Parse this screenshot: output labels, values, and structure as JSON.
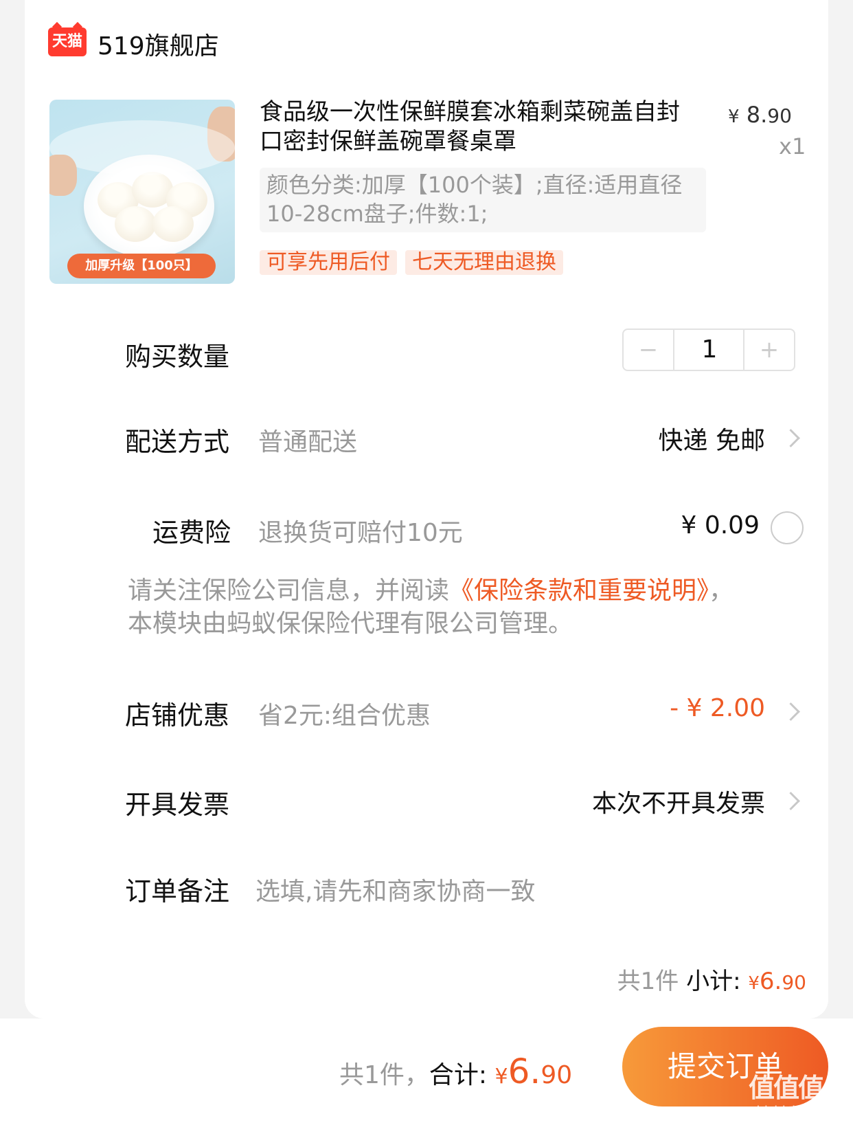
{
  "shop": {
    "logo_text": "天猫",
    "name": "519旗舰店"
  },
  "product": {
    "image_badge": "加厚升级【100只】",
    "title": "食品级一次性保鲜膜套冰箱剩菜碗盖自封口密封保鲜盖碗罩餐桌罩",
    "price_symbol": "¥",
    "price_int": "8.",
    "price_dec": "90",
    "qty": "x1",
    "sku": "颜色分类:加厚【100个装】;直径:适用直径10-28cm盘子;件数:1;",
    "tags": [
      "可享先用后付",
      "七天无理由退换"
    ]
  },
  "quantity": {
    "label": "购买数量",
    "value": "1",
    "minus": "−",
    "plus": "+"
  },
  "delivery": {
    "label": "配送方式",
    "sub": "普通配送",
    "value": "快递 免邮"
  },
  "insurance": {
    "label": "运费险",
    "sub": "退换货可赔付10元",
    "value": "¥ 0.09",
    "notice_prefix": "请关注保险公司信息，并阅读",
    "notice_link": "《保险条款和重要说明》",
    "notice_suffix": "，本模块由蚂蚁保保险代理有限公司管理。"
  },
  "discount": {
    "label": "店铺优惠",
    "sub": "省2元:组合优惠",
    "value": "- ¥ 2.00"
  },
  "invoice": {
    "label": "开具发票",
    "value": "本次不开具发票"
  },
  "remark": {
    "label": "订单备注",
    "placeholder": "选填,请先和商家协商一致"
  },
  "subtotal": {
    "count": "共1件",
    "label": "小计:",
    "symbol": "¥",
    "int": "6.",
    "dec": "90"
  },
  "footer": {
    "count": "共1件，",
    "label": "合计:",
    "symbol": "¥",
    "int": "6.",
    "dec": "90",
    "submit": "提交订单",
    "watermark": "值值值",
    "watermark_url": "zhizhizhi.com"
  },
  "colors": {
    "accent": "#ee5a24",
    "tmall_red": "#ff3b2f"
  }
}
